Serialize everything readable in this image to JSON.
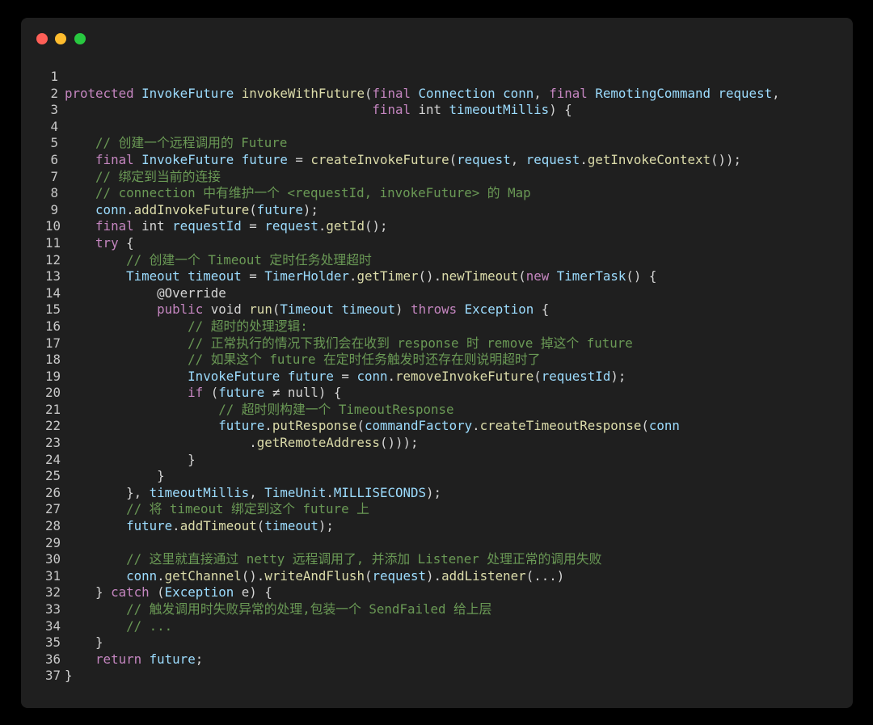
{
  "window": {
    "controls": [
      "close",
      "minimize",
      "maximize"
    ],
    "colors": {
      "close": "#ff5f57",
      "minimize": "#febc2e",
      "maximize": "#28c840",
      "background": "#1f1f1f"
    }
  },
  "code": {
    "lines": [
      {
        "n": "1",
        "tokens": []
      },
      {
        "n": "2",
        "tokens": [
          [
            "kw",
            "protected"
          ],
          [
            "pl",
            " "
          ],
          [
            "ty",
            "InvokeFuture"
          ],
          [
            "pl",
            " "
          ],
          [
            "fn",
            "invokeWithFuture"
          ],
          [
            "pl",
            "("
          ],
          [
            "kw",
            "final"
          ],
          [
            "pl",
            " "
          ],
          [
            "ty",
            "Connection"
          ],
          [
            "pl",
            " "
          ],
          [
            "ty",
            "conn"
          ],
          [
            "pl",
            ", "
          ],
          [
            "kw",
            "final"
          ],
          [
            "pl",
            " "
          ],
          [
            "ty",
            "RemotingCommand"
          ],
          [
            "pl",
            " "
          ],
          [
            "ty",
            "request"
          ],
          [
            "pl",
            ","
          ]
        ]
      },
      {
        "n": "3",
        "tokens": [
          [
            "pl",
            "                                        "
          ],
          [
            "kw",
            "final"
          ],
          [
            "pl",
            " int "
          ],
          [
            "ty",
            "timeoutMillis"
          ],
          [
            "pl",
            ") {"
          ]
        ]
      },
      {
        "n": "4",
        "tokens": []
      },
      {
        "n": "5",
        "tokens": [
          [
            "pl",
            "    "
          ],
          [
            "cm",
            "// 创建一个远程调用的 Future"
          ]
        ]
      },
      {
        "n": "6",
        "tokens": [
          [
            "pl",
            "    "
          ],
          [
            "kw",
            "final"
          ],
          [
            "pl",
            " "
          ],
          [
            "ty",
            "InvokeFuture"
          ],
          [
            "pl",
            " "
          ],
          [
            "ty",
            "future"
          ],
          [
            "pl",
            " = "
          ],
          [
            "fn",
            "createInvokeFuture"
          ],
          [
            "pl",
            "("
          ],
          [
            "ty",
            "request"
          ],
          [
            "pl",
            ", "
          ],
          [
            "ty",
            "request"
          ],
          [
            "pl",
            "."
          ],
          [
            "fn",
            "getInvokeContext"
          ],
          [
            "pl",
            "());"
          ]
        ]
      },
      {
        "n": "7",
        "tokens": [
          [
            "pl",
            "    "
          ],
          [
            "cm",
            "// 绑定到当前的连接"
          ]
        ]
      },
      {
        "n": "8",
        "tokens": [
          [
            "pl",
            "    "
          ],
          [
            "cm",
            "// connection 中有维护一个 <requestId, invokeFuture> 的 Map"
          ]
        ]
      },
      {
        "n": "9",
        "tokens": [
          [
            "pl",
            "    "
          ],
          [
            "ty",
            "conn"
          ],
          [
            "pl",
            "."
          ],
          [
            "fn",
            "addInvokeFuture"
          ],
          [
            "pl",
            "("
          ],
          [
            "ty",
            "future"
          ],
          [
            "pl",
            ");"
          ]
        ]
      },
      {
        "n": "10",
        "tokens": [
          [
            "pl",
            "    "
          ],
          [
            "kw",
            "final"
          ],
          [
            "pl",
            " int "
          ],
          [
            "ty",
            "requestId"
          ],
          [
            "pl",
            " = "
          ],
          [
            "ty",
            "request"
          ],
          [
            "pl",
            "."
          ],
          [
            "fn",
            "getId"
          ],
          [
            "pl",
            "();"
          ]
        ]
      },
      {
        "n": "11",
        "tokens": [
          [
            "pl",
            "    "
          ],
          [
            "kw",
            "try"
          ],
          [
            "pl",
            " {"
          ]
        ]
      },
      {
        "n": "12",
        "tokens": [
          [
            "pl",
            "        "
          ],
          [
            "cm",
            "// 创建一个 Timeout 定时任务处理超时"
          ]
        ]
      },
      {
        "n": "13",
        "tokens": [
          [
            "pl",
            "        "
          ],
          [
            "ty",
            "Timeout"
          ],
          [
            "pl",
            " "
          ],
          [
            "ty",
            "timeout"
          ],
          [
            "pl",
            " = "
          ],
          [
            "ty",
            "TimerHolder"
          ],
          [
            "pl",
            "."
          ],
          [
            "fn",
            "getTimer"
          ],
          [
            "pl",
            "()."
          ],
          [
            "fn",
            "newTimeout"
          ],
          [
            "pl",
            "("
          ],
          [
            "kw",
            "new"
          ],
          [
            "pl",
            " "
          ],
          [
            "ty",
            "TimerTask"
          ],
          [
            "pl",
            "() {"
          ]
        ]
      },
      {
        "n": "14",
        "tokens": [
          [
            "pl",
            "            @Override"
          ]
        ]
      },
      {
        "n": "15",
        "tokens": [
          [
            "pl",
            "            "
          ],
          [
            "kw",
            "public"
          ],
          [
            "pl",
            " void "
          ],
          [
            "fn",
            "run"
          ],
          [
            "pl",
            "("
          ],
          [
            "ty",
            "Timeout"
          ],
          [
            "pl",
            " "
          ],
          [
            "ty",
            "timeout"
          ],
          [
            "pl",
            ") "
          ],
          [
            "kw",
            "throws"
          ],
          [
            "pl",
            " "
          ],
          [
            "ty",
            "Exception"
          ],
          [
            "pl",
            " {"
          ]
        ]
      },
      {
        "n": "16",
        "tokens": [
          [
            "pl",
            "                "
          ],
          [
            "cm",
            "// 超时的处理逻辑:"
          ]
        ]
      },
      {
        "n": "17",
        "tokens": [
          [
            "pl",
            "                "
          ],
          [
            "cm",
            "// 正常执行的情况下我们会在收到 response 时 remove 掉这个 future"
          ]
        ]
      },
      {
        "n": "18",
        "tokens": [
          [
            "pl",
            "                "
          ],
          [
            "cm",
            "// 如果这个 future 在定时任务触发时还存在则说明超时了"
          ]
        ]
      },
      {
        "n": "19",
        "tokens": [
          [
            "pl",
            "                "
          ],
          [
            "ty",
            "InvokeFuture"
          ],
          [
            "pl",
            " "
          ],
          [
            "ty",
            "future"
          ],
          [
            "pl",
            " = "
          ],
          [
            "ty",
            "conn"
          ],
          [
            "pl",
            "."
          ],
          [
            "fn",
            "removeInvokeFuture"
          ],
          [
            "pl",
            "("
          ],
          [
            "ty",
            "requestId"
          ],
          [
            "pl",
            ");"
          ]
        ]
      },
      {
        "n": "20",
        "tokens": [
          [
            "pl",
            "                "
          ],
          [
            "kw",
            "if"
          ],
          [
            "pl",
            " ("
          ],
          [
            "ty",
            "future"
          ],
          [
            "pl",
            " ≠ null) {"
          ]
        ]
      },
      {
        "n": "21",
        "tokens": [
          [
            "pl",
            "                    "
          ],
          [
            "cm",
            "// 超时则构建一个 TimeoutResponse"
          ]
        ]
      },
      {
        "n": "22",
        "tokens": [
          [
            "pl",
            "                    "
          ],
          [
            "ty",
            "future"
          ],
          [
            "pl",
            "."
          ],
          [
            "fn",
            "putResponse"
          ],
          [
            "pl",
            "("
          ],
          [
            "ty",
            "commandFactory"
          ],
          [
            "pl",
            "."
          ],
          [
            "fn",
            "createTimeoutResponse"
          ],
          [
            "pl",
            "("
          ],
          [
            "ty",
            "conn"
          ]
        ]
      },
      {
        "n": "23",
        "tokens": [
          [
            "pl",
            "                        ."
          ],
          [
            "fn",
            "getRemoteAddress"
          ],
          [
            "pl",
            "()));"
          ]
        ]
      },
      {
        "n": "24",
        "tokens": [
          [
            "pl",
            "                }"
          ]
        ]
      },
      {
        "n": "25",
        "tokens": [
          [
            "pl",
            "            }"
          ]
        ]
      },
      {
        "n": "26",
        "tokens": [
          [
            "pl",
            "        }, "
          ],
          [
            "ty",
            "timeoutMillis"
          ],
          [
            "pl",
            ", "
          ],
          [
            "ty",
            "TimeUnit"
          ],
          [
            "pl",
            "."
          ],
          [
            "ty",
            "MILLISECONDS"
          ],
          [
            "pl",
            ");"
          ]
        ]
      },
      {
        "n": "27",
        "tokens": [
          [
            "pl",
            "        "
          ],
          [
            "cm",
            "// 将 timeout 绑定到这个 future 上"
          ]
        ]
      },
      {
        "n": "28",
        "tokens": [
          [
            "pl",
            "        "
          ],
          [
            "ty",
            "future"
          ],
          [
            "pl",
            "."
          ],
          [
            "fn",
            "addTimeout"
          ],
          [
            "pl",
            "("
          ],
          [
            "ty",
            "timeout"
          ],
          [
            "pl",
            ");"
          ]
        ]
      },
      {
        "n": "29",
        "tokens": []
      },
      {
        "n": "30",
        "tokens": [
          [
            "pl",
            "        "
          ],
          [
            "cm",
            "// 这里就直接通过 netty 远程调用了, 并添加 Listener 处理正常的调用失败"
          ]
        ]
      },
      {
        "n": "31",
        "tokens": [
          [
            "pl",
            "        "
          ],
          [
            "ty",
            "conn"
          ],
          [
            "pl",
            "."
          ],
          [
            "fn",
            "getChannel"
          ],
          [
            "pl",
            "()."
          ],
          [
            "fn",
            "writeAndFlush"
          ],
          [
            "pl",
            "("
          ],
          [
            "ty",
            "request"
          ],
          [
            "pl",
            ")."
          ],
          [
            "fn",
            "addListener"
          ],
          [
            "pl",
            "(...)"
          ]
        ]
      },
      {
        "n": "32",
        "tokens": [
          [
            "pl",
            "    } "
          ],
          [
            "kw",
            "catch"
          ],
          [
            "pl",
            " ("
          ],
          [
            "ty",
            "Exception"
          ],
          [
            "pl",
            " e) {"
          ]
        ]
      },
      {
        "n": "33",
        "tokens": [
          [
            "pl",
            "        "
          ],
          [
            "cm",
            "// 触发调用时失败异常的处理,包装一个 SendFailed 给上层"
          ]
        ]
      },
      {
        "n": "34",
        "tokens": [
          [
            "pl",
            "        "
          ],
          [
            "cm",
            "// ..."
          ]
        ]
      },
      {
        "n": "35",
        "tokens": [
          [
            "pl",
            "    }"
          ]
        ]
      },
      {
        "n": "36",
        "tokens": [
          [
            "pl",
            "    "
          ],
          [
            "kw",
            "return"
          ],
          [
            "pl",
            " "
          ],
          [
            "ty",
            "future"
          ],
          [
            "pl",
            ";"
          ]
        ]
      },
      {
        "n": "37",
        "tokens": [
          [
            "pl",
            "}"
          ]
        ]
      }
    ]
  }
}
